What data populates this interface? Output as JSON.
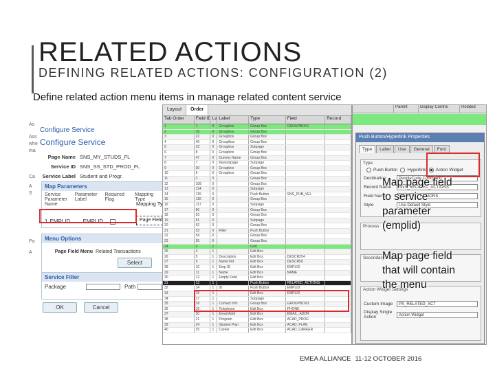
{
  "slide": {
    "title": "RELATED ACTIONS",
    "subtitle": "DEFINING RELATED ACTIONS: CONFIGURATION (2)",
    "body": "Define related action menu items in manage related content service",
    "callout_top": [
      "Map page field",
      "to service",
      "parameter",
      "(emplid)"
    ],
    "callout_bottom": [
      "Map page field",
      "that will contain",
      "the menu"
    ]
  },
  "footer": {
    "org": "EMEA ALLIANCE",
    "date": "11-12 OCTOBER 2016"
  },
  "configure_service": {
    "head_small": "Configure Service",
    "head": "Configure Service",
    "page_name_label": "Page Name",
    "page_name": "SNS_MY_STUDS_FL",
    "service_id_label": "Service ID",
    "service_id": "SNS_SS_STD_PROD_FL",
    "service_label_label": "Service Label",
    "service_label": "Student and Progr.",
    "map_parameters": {
      "title": "Map Parameters",
      "columns": [
        "Service Parameter Name",
        "Parameter Label",
        "Required Flag",
        "Mapping Type"
      ],
      "row": {
        "num": "1",
        "name": "EMPLID",
        "label": "EMPLID"
      },
      "page_field_label": "Page Field"
    },
    "menu_options": {
      "title": "Menu Options",
      "page_field_menu_label": "Page Field Menu",
      "page_field_menu_value": "Related Transactions",
      "select_label": "Select"
    },
    "service_filter": {
      "title": "Service Filter",
      "package_label": "Package",
      "path_label": "Path"
    },
    "ok_label": "OK",
    "cancel_label": "Cancel",
    "edge_letters": [
      "As",
      "Ass",
      "whe",
      "ma",
      "Ca",
      "A",
      "S",
      "Pa",
      "A"
    ]
  },
  "record_grid": {
    "tabs": [
      "Layout",
      "Order"
    ],
    "headers": [
      "Tab Order",
      "Field ID",
      "Lvl",
      "Label",
      "Type",
      "Field",
      "Record"
    ],
    "rows": [
      [
        "1",
        "1",
        "0",
        "Groupbox",
        "Group Box",
        "GROUPBOX1",
        "",
        "hl"
      ],
      [
        "2",
        "16",
        "0",
        "Groupbox",
        "Group Box",
        "",
        "",
        "hl"
      ],
      [
        "3",
        "22",
        "0",
        "Groupbox",
        "Group Box",
        "",
        "",
        ""
      ],
      [
        "4",
        "40",
        "0",
        "Grouplbox",
        "Group Box",
        "",
        "",
        ""
      ],
      [
        "5",
        "23",
        "0",
        "Groupbox",
        "Subpage",
        "",
        "",
        ""
      ],
      [
        "6",
        "8",
        "0",
        "Groupbox",
        "Group Box",
        "",
        "",
        ""
      ],
      [
        "7",
        "47",
        "0",
        "Dummy Name",
        "Group Box",
        "",
        "",
        ""
      ],
      [
        "8",
        "7",
        "0",
        "Keysubpage",
        "Subpage",
        "",
        "",
        ""
      ],
      [
        "9",
        "30",
        "0",
        "Groupbox",
        "Group Box",
        "",
        "",
        ""
      ],
      [
        "10",
        "6",
        "0",
        "Groupbox",
        "Group Box",
        "",
        "",
        ""
      ],
      [
        "11",
        "2",
        "0",
        "",
        "Group Box",
        "",
        "",
        ""
      ],
      [
        "12",
        "108",
        "0",
        "",
        "Group Box",
        "",
        "",
        ""
      ],
      [
        "13",
        "114",
        "0",
        "",
        "Subpage",
        "",
        "",
        ""
      ],
      [
        "14",
        "115",
        "0",
        "",
        "Push Button",
        "SNS_PUB_VEL",
        "",
        ""
      ],
      [
        "15",
        "116",
        "0",
        "",
        "Group Box",
        "",
        "",
        ""
      ],
      [
        "16",
        "117",
        "0",
        "",
        "Subpage",
        "",
        "",
        ""
      ],
      [
        "17",
        "50",
        "0",
        "",
        "Group Box",
        "",
        "",
        ""
      ],
      [
        "18",
        "53",
        "0",
        "",
        "Group Box",
        "",
        "",
        ""
      ],
      [
        "19",
        "51",
        "0",
        "",
        "Subpage",
        "",
        "",
        ""
      ],
      [
        "20",
        "52",
        "0",
        "",
        "Group Box",
        "",
        "",
        ""
      ],
      [
        "21",
        "53",
        "0",
        "Filter",
        "Push Button",
        "",
        "",
        ""
      ],
      [
        "22",
        "54",
        "0",
        "",
        "Group Box",
        "",
        "",
        ""
      ],
      [
        "23",
        "55",
        "0",
        "",
        "Group Box",
        "",
        "",
        ""
      ],
      [
        "24",
        "3",
        "1",
        "",
        "Grid",
        "",
        "",
        "hl"
      ],
      [
        "25",
        "4",
        "1",
        "",
        "Edit Box",
        "",
        "",
        ""
      ],
      [
        "26",
        "5",
        "1",
        "Description",
        "Edit Box",
        "DESCR254",
        "",
        ""
      ],
      [
        "27",
        "9",
        "1",
        "Name Fld",
        "Edit Box",
        "DESCR50",
        "",
        ""
      ],
      [
        "28",
        "10",
        "1",
        "Emp ID",
        "Edit Box",
        "EMPLID",
        "",
        ""
      ],
      [
        "29",
        "11",
        "1",
        "Name",
        "Edit Box",
        "NAME",
        "",
        ""
      ],
      [
        "30",
        "12",
        "1",
        "Empty Field",
        "Edit Box",
        "",
        "",
        ""
      ],
      [
        "31",
        "13",
        "1",
        "",
        "Push Button",
        "RELATED_ACTIONS",
        "",
        "sel"
      ],
      [
        "32",
        "14",
        "1",
        "ID",
        "Push Button",
        "EMPLID",
        "",
        ""
      ],
      [
        "33",
        "15",
        "1",
        "",
        "Edit Box",
        "EMPLID",
        "",
        ""
      ],
      [
        "34",
        "17",
        "1",
        "",
        "Subpage",
        "",
        "",
        ""
      ],
      [
        "35",
        "18",
        "1",
        "Contact Info",
        "Group Box",
        "GROUPBOX3",
        "",
        ""
      ],
      [
        "36",
        "19",
        "1",
        "Telephone",
        "Edit Box",
        "PHONE",
        "",
        ""
      ],
      [
        "37",
        "20",
        "1",
        "Email Addr",
        "Edit Box",
        "EMAIL_ADDR",
        "",
        ""
      ],
      [
        "38",
        "21",
        "1",
        "Program",
        "Edit Box",
        "ACAD_PROG",
        "",
        ""
      ],
      [
        "39",
        "24",
        "1",
        "Student Plan",
        "Edit Box",
        "ACAD_PLAN",
        "",
        ""
      ],
      [
        "40",
        "25",
        "1",
        "Career",
        "Edit Box",
        "ACAD_CAREER",
        "",
        ""
      ]
    ]
  },
  "properties_grid": {
    "headers": [
      "Parent",
      "Display Control",
      "Related"
    ],
    "dialog_title": "Push Button/Hyperlink Properties",
    "dialog_tabs": [
      "Type",
      "Label",
      "Use",
      "General",
      "Font"
    ],
    "type_legend": "Type",
    "radio_push_button": "Push Button",
    "radio_hyperlink": "Hyperlink",
    "radio_action_widget": "Action Widget",
    "destination_label": "Destination",
    "destination_value": "PeopleCode Command",
    "record_name_label": "Record Name",
    "record_name_value": "SNS_RELATED_ACTIONS",
    "field_name_label": "Field Name",
    "field_name_value": "RELATED_ACTIONS",
    "style_label": "Style",
    "style_value": "Use Default Style",
    "process_legend": "Process",
    "secondary_legend": "Secondary Page",
    "action_widget_legend": "Action Widget Settings",
    "custom_image_label": "Custom Image",
    "custom_image_value": "PS_RELATED_ACT",
    "display_label": "Display Single Action",
    "display_value": "Action Widget"
  }
}
